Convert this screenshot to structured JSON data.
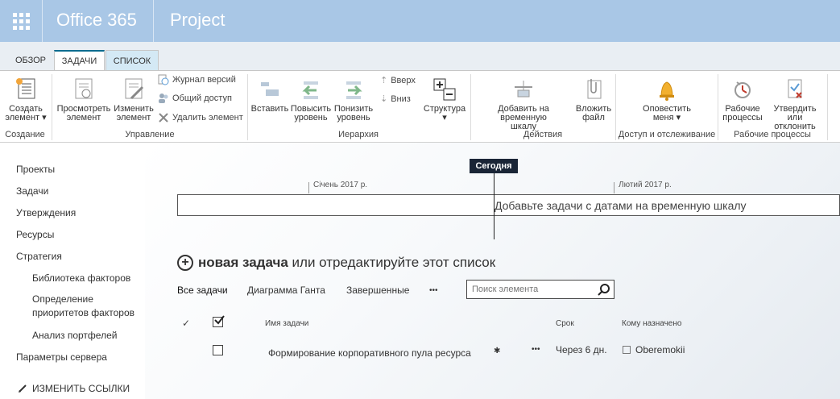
{
  "suite": {
    "brand": "Office 365",
    "app": "Project"
  },
  "tabs": [
    {
      "label": "ОБЗОР"
    },
    {
      "label": "ЗАДАЧИ"
    },
    {
      "label": "СПИСОК"
    }
  ],
  "ribbon": {
    "groups": {
      "create": "Создание",
      "manage": "Управление",
      "hierarchy": "Иерархия",
      "actions": "Действия",
      "access": "Доступ и отслеживание",
      "workflows": "Рабочие процессы"
    },
    "new_item": {
      "line1": "Создать",
      "line2": "элемент"
    },
    "view_item": {
      "line1": "Просмотреть",
      "line2": "элемент"
    },
    "edit_item": {
      "line1": "Изменить",
      "line2": "элемент"
    },
    "version_history": "Журнал версий",
    "shared_with": "Общий доступ",
    "delete_item": "Удалить элемент",
    "indent": "Вставить",
    "outdent": {
      "line1": "Повысить",
      "line2": "уровень"
    },
    "lower": {
      "line1": "Понизить",
      "line2": "уровень"
    },
    "move_up": "Вверх",
    "move_down": "Вниз",
    "structure": "Структура",
    "add_timeline": {
      "line1": "Добавить на временную",
      "line2": "шкалу"
    },
    "attach_file": {
      "line1": "Вложить",
      "line2": "файл"
    },
    "alert_me": {
      "line1": "Оповестить",
      "line2": "меня"
    },
    "workflows_btn": {
      "line1": "Рабочие",
      "line2": "процессы"
    },
    "approve": {
      "line1": "Утвердить или",
      "line2": "отклонить"
    }
  },
  "nav": {
    "items": [
      "Проекты",
      "Задачи",
      "Утверждения",
      "Ресурсы",
      "Стратегия"
    ],
    "sub_items": [
      "Библиотека факторов",
      "Определение",
      "приоритетов факторов",
      "Анализ портфелей"
    ],
    "server_settings": "Параметры сервера",
    "edit_links": "ИЗМЕНИТЬ ССЫЛКИ"
  },
  "timeline": {
    "today": "Сегодня",
    "months": [
      "Січень 2017 р.",
      "Лютий 2017 р."
    ],
    "hint": "Добавьте задачи с датами на временную шкалу"
  },
  "newtask": {
    "bold": "новая задача",
    "rest": " или отредактируйте этот список"
  },
  "views": {
    "all": "Все задачи",
    "gantt": "Диаграмма Ганта",
    "completed": "Завершенные",
    "more": "•••"
  },
  "search": {
    "placeholder": "Поиск элемента"
  },
  "list": {
    "headers": {
      "check": "✓",
      "name": "Имя задачи",
      "due": "Срок",
      "assigned": "Кому назначено"
    },
    "rows": [
      {
        "name": "Формирование корпоративного пула ресурса",
        "new_mark": "✱",
        "due": "Через 6 дн.",
        "assigned": "Oberemokii",
        "more": "•••"
      }
    ]
  },
  "colors": {
    "suite_bar": "#a9c7e6",
    "active_tab_accent": "#0a6c8f",
    "today_marker": "#1a2536"
  }
}
